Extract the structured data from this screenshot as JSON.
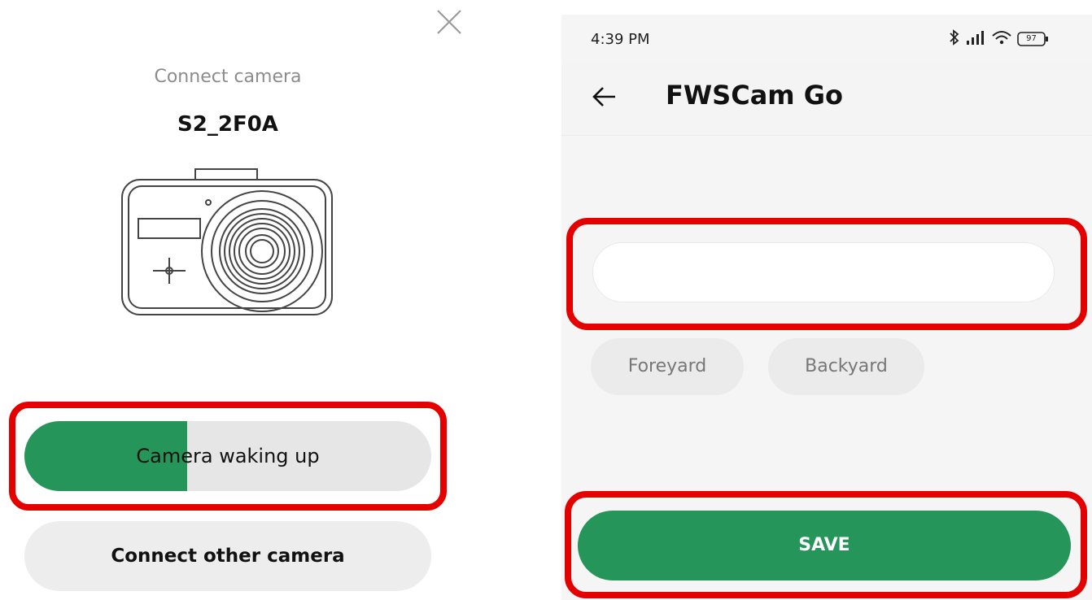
{
  "left_panel": {
    "close_icon": "close-icon",
    "connect_title": "Connect camera",
    "camera_name": "S2_2F0A",
    "camera_illustration": "camera-icon",
    "progress": {
      "label": "Camera waking up",
      "fraction": 0.4,
      "fill_color": "#25955a",
      "track_color": "#e6e6e6"
    },
    "other_button_label": "Connect other camera"
  },
  "right_panel": {
    "status_bar": {
      "time": "4:39 PM",
      "battery_level": "97",
      "icons": [
        "bluetooth-icon",
        "signal-icon",
        "wifi-icon",
        "battery-icon"
      ]
    },
    "header": {
      "back_icon": "back-arrow-icon",
      "title": "FWSCam Go"
    },
    "name_input": {
      "value": "",
      "placeholder": ""
    },
    "suggestions": [
      "Foreyard",
      "Backyard"
    ],
    "save_label": "SAVE"
  },
  "colors": {
    "accent": "#25955a",
    "highlight": "#e50000"
  }
}
